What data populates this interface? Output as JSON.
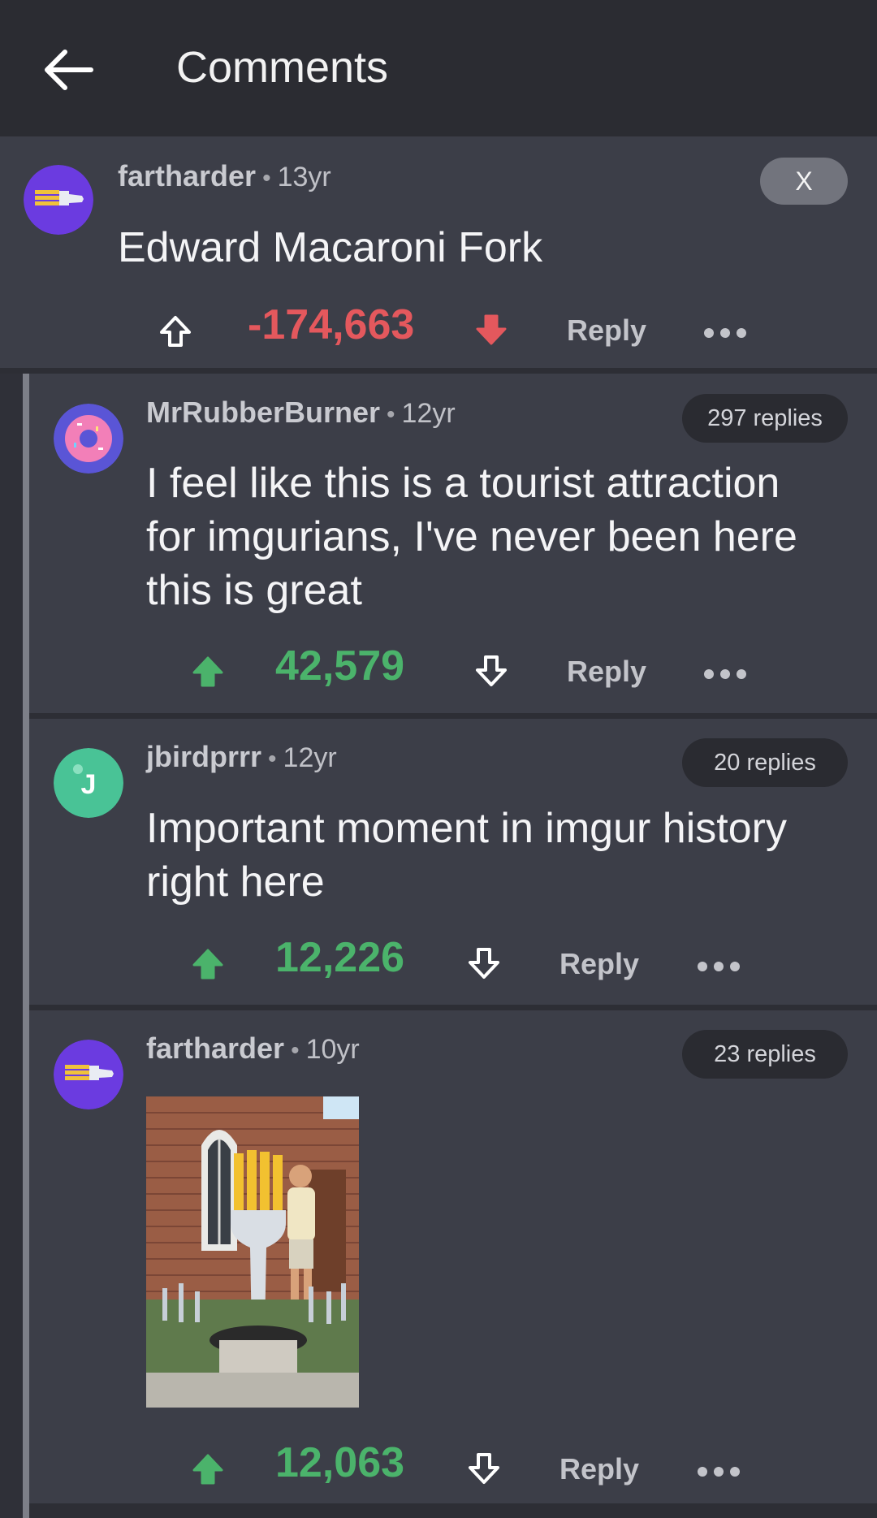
{
  "header": {
    "title": "Comments",
    "back_icon": "arrow-left-icon"
  },
  "top_comment": {
    "username": "fartharder",
    "age": "13yr",
    "text": "Edward Macaroni Fork",
    "score": "-174,663",
    "reply_label": "Reply",
    "close_label": "X",
    "avatar_icon": "fork-icon",
    "avatar_color": "#6b3be0"
  },
  "replies": [
    {
      "username": "MrRubberBurner",
      "age": "12yr",
      "replies_label": "297 replies",
      "text_lines": [
        "I feel like this is a tourist attraction",
        "for imgurians, I've never been here",
        "this is great"
      ],
      "score": "42,579",
      "reply_label": "Reply",
      "avatar_icon": "donut-icon"
    },
    {
      "username": "jbirdprrr",
      "age": "12yr",
      "replies_label": "20 replies",
      "text_lines": [
        "Important moment in imgur history",
        "right here"
      ],
      "score": "12,226",
      "reply_label": "Reply",
      "avatar_letter": "J",
      "avatar_color": "#49c396"
    },
    {
      "username": "fartharder",
      "age": "10yr",
      "replies_label": "23 replies",
      "image_icon": "macaroni-fork-photo",
      "score": "12,063",
      "reply_label": "Reply",
      "avatar_icon": "fork-icon"
    }
  ],
  "colors": {
    "downvote_active": "#e4585d",
    "upvote_active": "#4bb36b",
    "background": "#3c3e48",
    "header": "#2b2c32"
  }
}
